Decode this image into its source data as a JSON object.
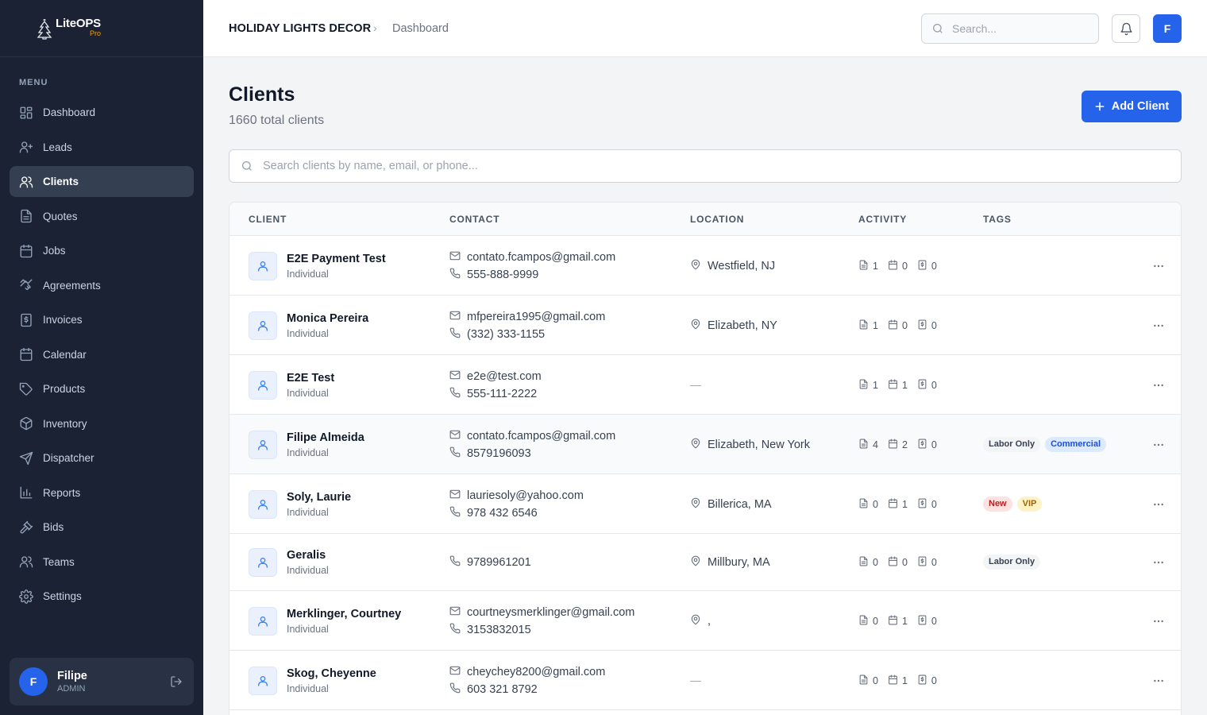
{
  "app": {
    "logo_name": "LiteOPS",
    "logo_sub": "Pro"
  },
  "sidebar": {
    "menu_label": "MENU",
    "items": [
      {
        "label": "Dashboard",
        "icon": "dashboard-icon"
      },
      {
        "label": "Leads",
        "icon": "user-plus-icon"
      },
      {
        "label": "Clients",
        "icon": "users-icon",
        "active": true
      },
      {
        "label": "Quotes",
        "icon": "document-icon"
      },
      {
        "label": "Jobs",
        "icon": "calendar-icon"
      },
      {
        "label": "Agreements",
        "icon": "handshake-icon"
      },
      {
        "label": "Invoices",
        "icon": "dollar-receipt-icon"
      },
      {
        "label": "Calendar",
        "icon": "calendar-icon"
      },
      {
        "label": "Products",
        "icon": "tag-icon"
      },
      {
        "label": "Inventory",
        "icon": "box-icon"
      },
      {
        "label": "Dispatcher",
        "icon": "send-icon"
      },
      {
        "label": "Reports",
        "icon": "bar-chart-icon"
      },
      {
        "label": "Bids",
        "icon": "gavel-icon"
      },
      {
        "label": "Teams",
        "icon": "users-icon"
      },
      {
        "label": "Settings",
        "icon": "gear-icon"
      }
    ],
    "user": {
      "initial": "F",
      "name": "Filipe",
      "role": "ADMIN"
    }
  },
  "header": {
    "company": "HOLIDAY LIGHTS DECOR",
    "separator": "›",
    "page": "Dashboard",
    "search_placeholder": "Search...",
    "avatar_initial": "F"
  },
  "main": {
    "title": "Clients",
    "subtitle": "1660 total clients",
    "add_button": "Add Client",
    "search_placeholder": "Search clients by name, email, or phone...",
    "columns": [
      "CLIENT",
      "CONTACT",
      "LOCATION",
      "ACTIVITY",
      "TAGS"
    ],
    "rows": [
      {
        "name": "E2E Payment Test",
        "type": "Individual",
        "email": "contato.fcampos@gmail.com",
        "phone": "555-888-9999",
        "location": "Westfield, NJ",
        "quotes": "1",
        "jobs": "0",
        "invoices": "0",
        "tags": []
      },
      {
        "name": "Monica Pereira",
        "type": "Individual",
        "email": "mfpereira1995@gmail.com",
        "phone": "(332) 333-1155",
        "location": "Elizabeth, NY",
        "quotes": "1",
        "jobs": "0",
        "invoices": "0",
        "tags": []
      },
      {
        "name": "E2E Test",
        "type": "Individual",
        "email": "e2e@test.com",
        "phone": "555-111-2222",
        "location": "—",
        "quotes": "1",
        "jobs": "1",
        "invoices": "0",
        "tags": []
      },
      {
        "name": "Filipe Almeida",
        "type": "Individual",
        "email": "contato.fcampos@gmail.com",
        "phone": "8579196093",
        "location": "Elizabeth, New York",
        "quotes": "4",
        "jobs": "2",
        "invoices": "0",
        "tags": [
          {
            "label": "Labor Only",
            "style": "gray"
          },
          {
            "label": "Commercial",
            "style": "blue"
          }
        ]
      },
      {
        "name": "Soly, Laurie",
        "type": "Individual",
        "email": "lauriesoly@yahoo.com",
        "phone": "978 432 6546",
        "location": "Billerica, MA",
        "quotes": "0",
        "jobs": "1",
        "invoices": "0",
        "tags": [
          {
            "label": "New",
            "style": "red"
          },
          {
            "label": "VIP",
            "style": "yellow"
          }
        ]
      },
      {
        "name": "Geralis",
        "type": "Individual",
        "email": "",
        "phone": "9789961201",
        "location": "Millbury, MA",
        "quotes": "0",
        "jobs": "0",
        "invoices": "0",
        "tags": [
          {
            "label": "Labor Only",
            "style": "gray"
          }
        ]
      },
      {
        "name": "Merklinger, Courtney",
        "type": "Individual",
        "email": "courtneysmerklinger@gmail.com",
        "phone": "3153832015",
        "location": ",",
        "quotes": "0",
        "jobs": "1",
        "invoices": "0",
        "tags": []
      },
      {
        "name": "Skog, Cheyenne",
        "type": "Individual",
        "email": "cheychey8200@gmail.com",
        "phone": "603 321 8792",
        "location": "—",
        "quotes": "0",
        "jobs": "1",
        "invoices": "0",
        "tags": []
      }
    ]
  },
  "colors": {
    "sidebar_bg": "#1a2233",
    "accent": "#2563eb",
    "active_nav_bg": "#353f52"
  }
}
